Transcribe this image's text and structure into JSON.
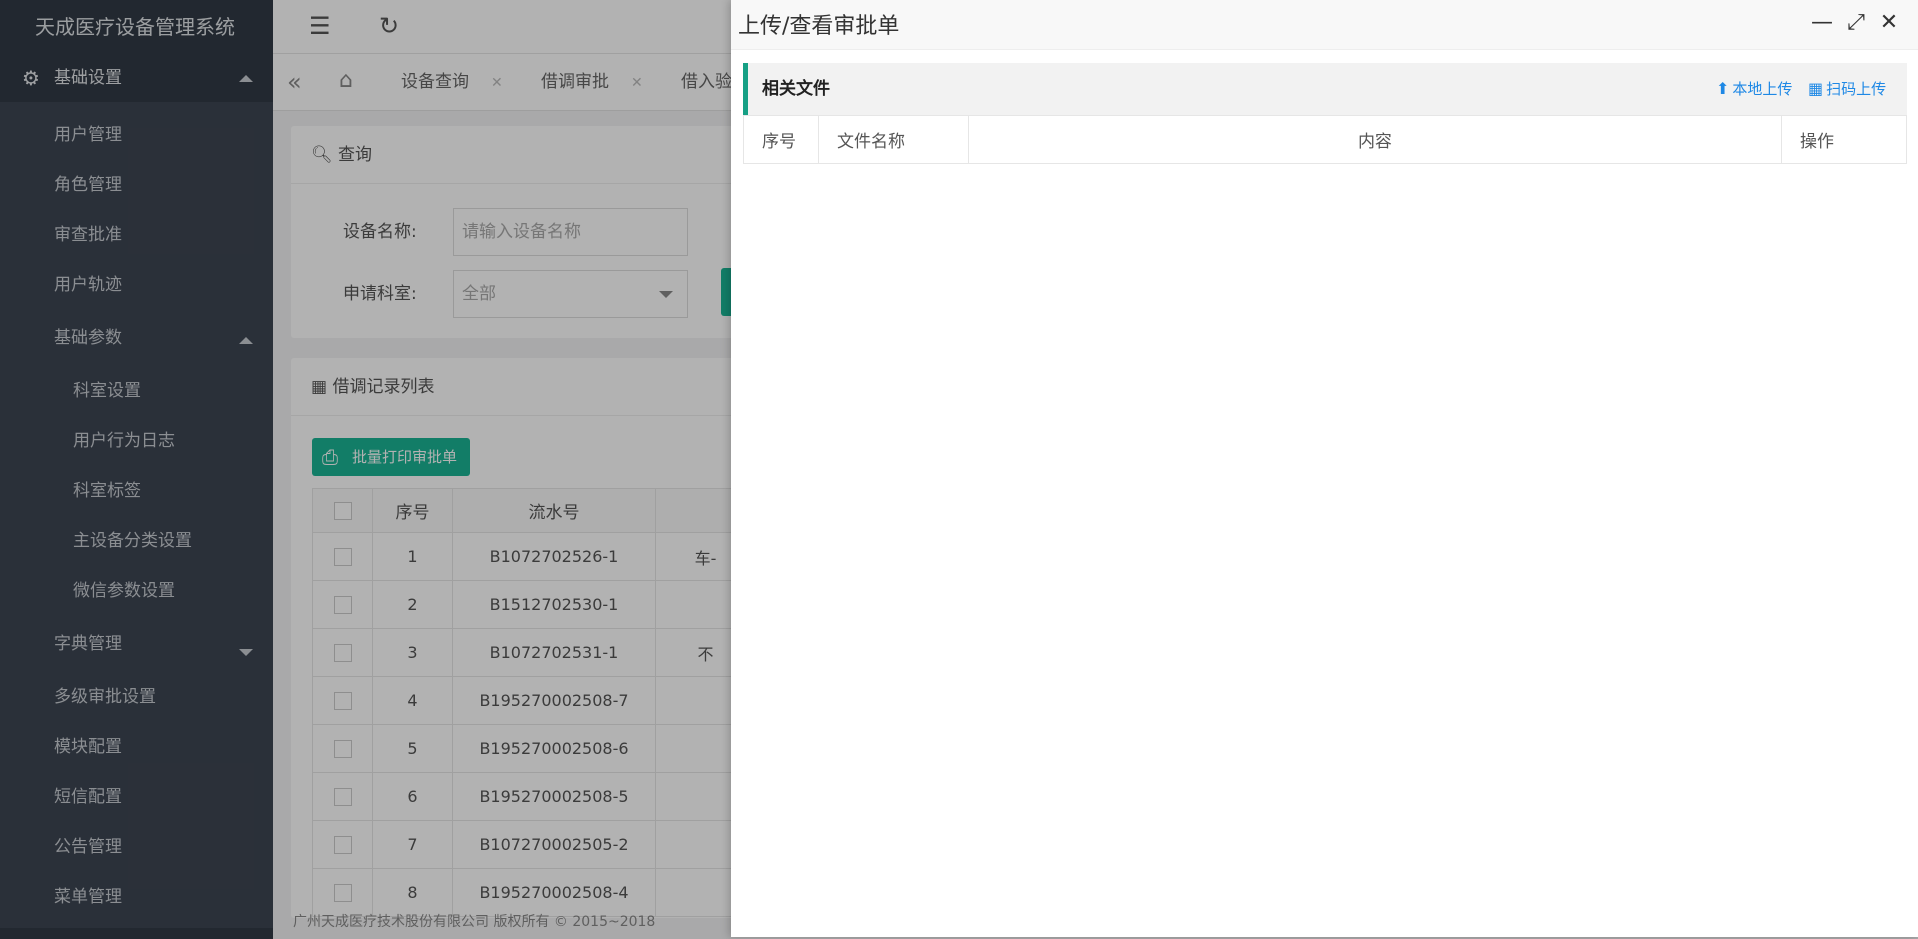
{
  "sidebar": {
    "brand": "天成医疗设备管理系统",
    "group_title": "基础设置",
    "items": [
      {
        "label": "用户管理"
      },
      {
        "label": "角色管理"
      },
      {
        "label": "审查批准"
      },
      {
        "label": "用户轨迹"
      }
    ],
    "sub_group": "基础参数",
    "sub_items": [
      {
        "label": "科室设置"
      },
      {
        "label": "用户行为日志"
      },
      {
        "label": "科室标签"
      },
      {
        "label": "主设备分类设置"
      },
      {
        "label": "微信参数设置"
      }
    ],
    "dict_group": "字典管理",
    "more_items": [
      {
        "label": "多级审批设置"
      },
      {
        "label": "模块配置"
      },
      {
        "label": "短信配置"
      },
      {
        "label": "公告管理"
      },
      {
        "label": "菜单管理"
      }
    ]
  },
  "tabs": [
    {
      "label": "设备查询"
    },
    {
      "label": "借调审批"
    },
    {
      "label": "借入验"
    }
  ],
  "query": {
    "title": "查询",
    "device_label": "设备名称:",
    "device_placeholder": "请输入设备名称",
    "dept_label": "申请科室:",
    "dept_value": "全部"
  },
  "list": {
    "title": "借调记录列表",
    "batch_print_label": "批量打印审批单",
    "columns": [
      "序号",
      "流水号"
    ],
    "rows": [
      {
        "no": "1",
        "serial": "B1072702526-1",
        "extra": "车-"
      },
      {
        "no": "2",
        "serial": "B1512702530-1",
        "extra": ""
      },
      {
        "no": "3",
        "serial": "B1072702531-1",
        "extra": "不"
      },
      {
        "no": "4",
        "serial": "B195270002508-7",
        "extra": ""
      },
      {
        "no": "5",
        "serial": "B195270002508-6",
        "extra": ""
      },
      {
        "no": "6",
        "serial": "B195270002508-5",
        "extra": ""
      },
      {
        "no": "7",
        "serial": "B107270002505-2",
        "extra": ""
      },
      {
        "no": "8",
        "serial": "B195270002508-4",
        "extra": ""
      }
    ]
  },
  "footer": "广州天成医疗技术股份有限公司 版权所有 © 2015~2018",
  "modal": {
    "title": "上传/查看审批单",
    "panel_title": "相关文件",
    "local_upload": "本地上传",
    "scan_upload": "扫码上传",
    "columns": {
      "no": "序号",
      "filename": "文件名称",
      "content": "内容",
      "action": "操作"
    }
  },
  "colors": {
    "sidebar_bg": "#323a45",
    "accent": "#1ab394",
    "panel_accent": "#16a085",
    "link": "#1e88e5"
  },
  "icons": {
    "menu_toggle": "indent-icon",
    "refresh": "refresh-icon",
    "settings": "gear-icon",
    "home": "home-icon",
    "upload": "upload-icon",
    "qr": "qrcode-icon"
  }
}
